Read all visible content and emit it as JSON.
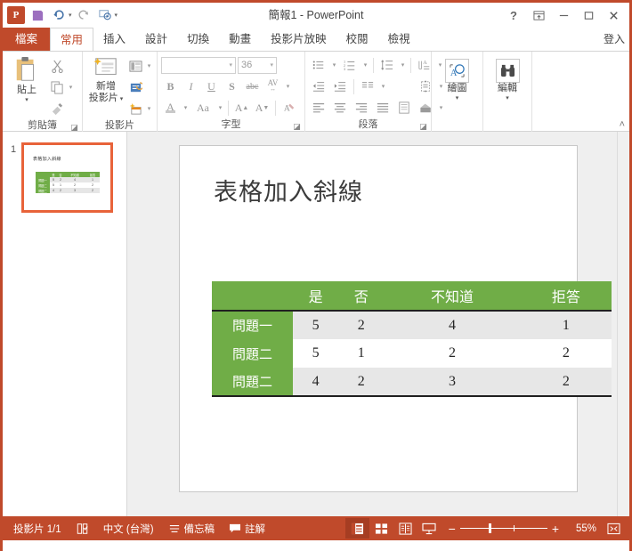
{
  "window": {
    "title": "簡報1 - PowerPoint",
    "app_logo": "P",
    "quick_access": [
      {
        "name": "save",
        "glyph": "ὋE"
      },
      {
        "name": "undo",
        "glyph": "↶"
      },
      {
        "name": "redo",
        "glyph": "↻"
      },
      {
        "name": "start-presentation",
        "glyph": "▷"
      },
      {
        "name": "customize-qat",
        "glyph": "▾"
      }
    ],
    "controls": {
      "help": "?",
      "ribbon_display": "ribbon-options",
      "minimize": "minimize",
      "restore": "restore",
      "close": "close"
    }
  },
  "tabs": {
    "file": "檔案",
    "items": [
      "常用",
      "插入",
      "設計",
      "切換",
      "動畫",
      "投影片放映",
      "校閱",
      "檢視"
    ],
    "active": "常用",
    "signin": "登入"
  },
  "ribbon": {
    "clipboard": {
      "label": "剪貼簿",
      "paste_label": "貼上",
      "cut_name": "cut-icon",
      "copy_name": "copy-icon",
      "format_painter_name": "format-painter-icon"
    },
    "slides": {
      "label": "投影片",
      "new_slide_line1": "新增",
      "new_slide_line2": "投影片",
      "layout_name": "layout-icon",
      "reset_name": "reset-icon",
      "section_name": "section-icon"
    },
    "font": {
      "label": "字型",
      "font_name": "",
      "font_name_placeholder": "",
      "font_size": "36",
      "bold": "B",
      "italic": "I",
      "underline": "U",
      "shadow": "S",
      "strikethrough": "abc",
      "char_spacing": "AV",
      "font_color": "A",
      "change_case": "Aa",
      "increase_size": "A",
      "decrease_size": "A",
      "clear_formatting": "clear-formatting-icon"
    },
    "paragraph": {
      "label": "段落",
      "bullets": "bullets-icon",
      "numbering": "numbering-icon",
      "line_spacing": "line-spacing-icon",
      "text_direction": "text-direction-icon",
      "decrease_indent": "decrease-indent-icon",
      "increase_indent": "increase-indent-icon",
      "align_left": "align-left-icon",
      "align_center": "align-center-icon",
      "align_right": "align-right-icon",
      "justify": "justify-icon",
      "columns": "columns-icon",
      "align_text": "align-text-icon",
      "smartart": "smartart-icon"
    },
    "drawing": {
      "label": "繪圖"
    },
    "editing": {
      "label": "編輯"
    },
    "collapse": "collapse-ribbon-icon"
  },
  "thumbnails": {
    "slides": [
      {
        "number": "1",
        "title": "表格加入斜線",
        "headers": [
          "",
          "是",
          "否",
          "不知道",
          "拒答"
        ],
        "rows": [
          [
            "問題一",
            "5",
            "2",
            "4",
            "1"
          ],
          [
            "問題二",
            "5",
            "1",
            "2",
            "2"
          ],
          [
            "問題二",
            "4",
            "2",
            "3",
            "2"
          ]
        ]
      }
    ]
  },
  "slide": {
    "title": "表格加入斜線",
    "table": {
      "headers": [
        "",
        "是",
        "否",
        "不知道",
        "拒答"
      ],
      "rows": [
        {
          "label": "問題一",
          "values": [
            "5",
            "2",
            "4",
            "1"
          ]
        },
        {
          "label": "問題二",
          "values": [
            "5",
            "1",
            "2",
            "2"
          ]
        },
        {
          "label": "問題二",
          "values": [
            "4",
            "2",
            "3",
            "2"
          ]
        }
      ],
      "header_bg": "#70AD47",
      "row_label_bg": "#70AD47",
      "band_bg": "#E7E7E7"
    }
  },
  "statusbar": {
    "slide_count": "投影片 1/1",
    "spellcheck": "spellcheck-icon",
    "language": "中文 (台灣)",
    "notes": "備忘稿",
    "comments": "註解",
    "views": [
      {
        "name": "normal-view",
        "active": true
      },
      {
        "name": "slide-sorter-view",
        "active": false
      },
      {
        "name": "reading-view",
        "active": false
      },
      {
        "name": "slideshow-view",
        "active": false
      }
    ],
    "zoom_out": "−",
    "zoom_in": "+",
    "zoom_level": "55%",
    "fit_slide": "fit-slide-icon"
  },
  "theme": {
    "accent": "#C04A2B",
    "table_green": "#70AD47"
  }
}
